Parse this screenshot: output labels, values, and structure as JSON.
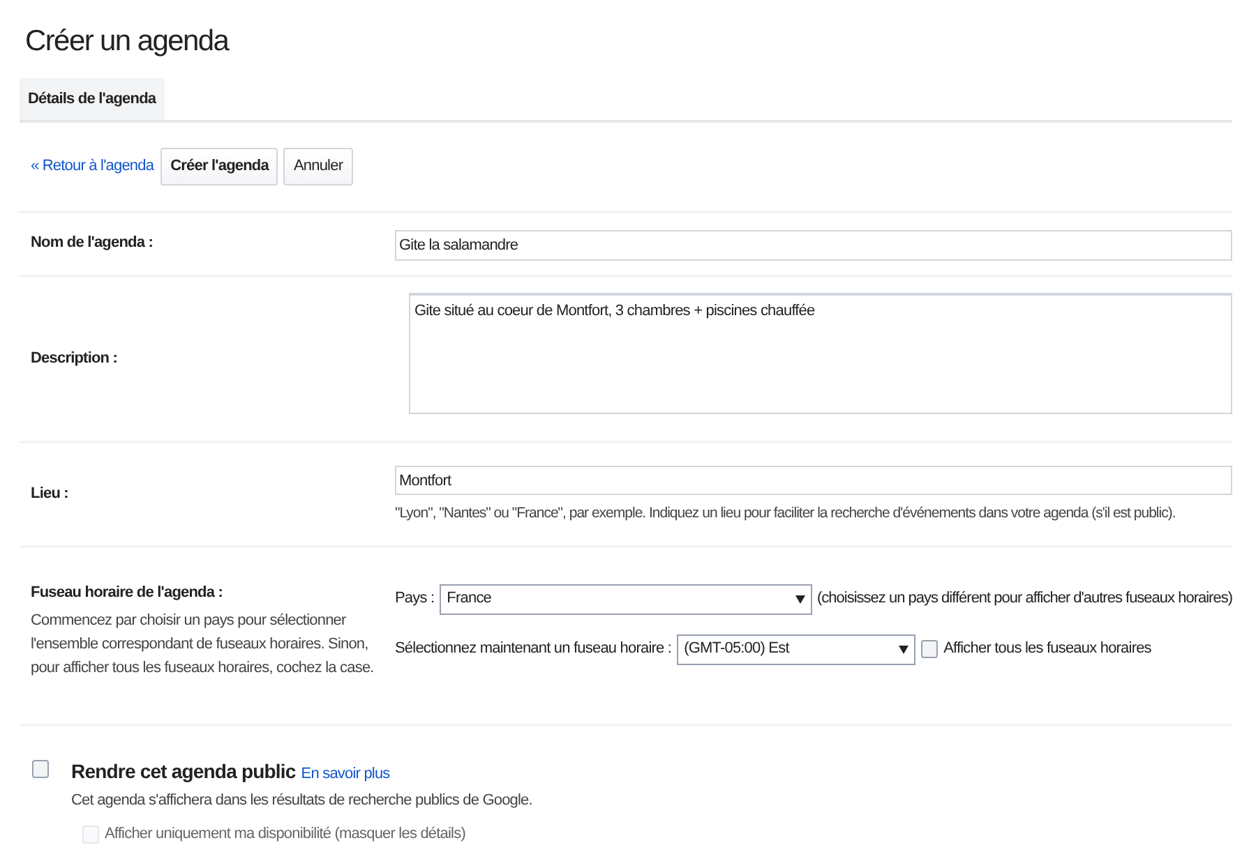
{
  "title": "Créer un agenda",
  "tabs": [
    {
      "label": "Détails de l'agenda",
      "selected": true
    }
  ],
  "toolbar": {
    "back_link": "« Retour à l'agenda",
    "buttons": [
      "Créer l'agenda",
      "Annuler"
    ]
  },
  "name_row": {
    "label": "Nom de l'agenda :",
    "value": "Gite la salamandre"
  },
  "description_row": {
    "label": "Description :",
    "value": "Gite situé au coeur de Montfort, 3 chambres + piscines chauffée"
  },
  "location_row": {
    "label": "Lieu :",
    "value": "Montfort",
    "hint": "\"Lyon\", \"Nantes\" ou \"France\", par exemple. Indiquez un lieu pour faciliter la recherche d'événements dans votre agenda (s'il est public)."
  },
  "timezone_row": {
    "label": "Fuseau horaire de l'agenda :",
    "help": "Commencez par choisir un pays pour sélectionner l'ensemble correspondant de fuseaux horaires. Sinon, pour afficher tous les fuseaux horaires, cochez la case.",
    "country_label": "Pays :",
    "country_value": "France",
    "country_note": "(choisissez un pays différent pour afficher d'autres fuseaux horaires)",
    "zone_label": "Sélectionnez maintenant un fuseau horaire :",
    "zone_value": "(GMT-05:00) Est",
    "show_all_label": "Afficher tous les fuseaux horaires",
    "show_all_checked": false
  },
  "public_section": {
    "label": "Rendre cet agenda public",
    "checked": false,
    "link": "En savoir plus",
    "note": "Cet agenda s'affichera dans les résultats de recherche publics de Google.",
    "availability_label": "Afficher uniquement ma disponibilité (masquer les détails)",
    "availability_checked": false,
    "availability_disabled": true
  }
}
